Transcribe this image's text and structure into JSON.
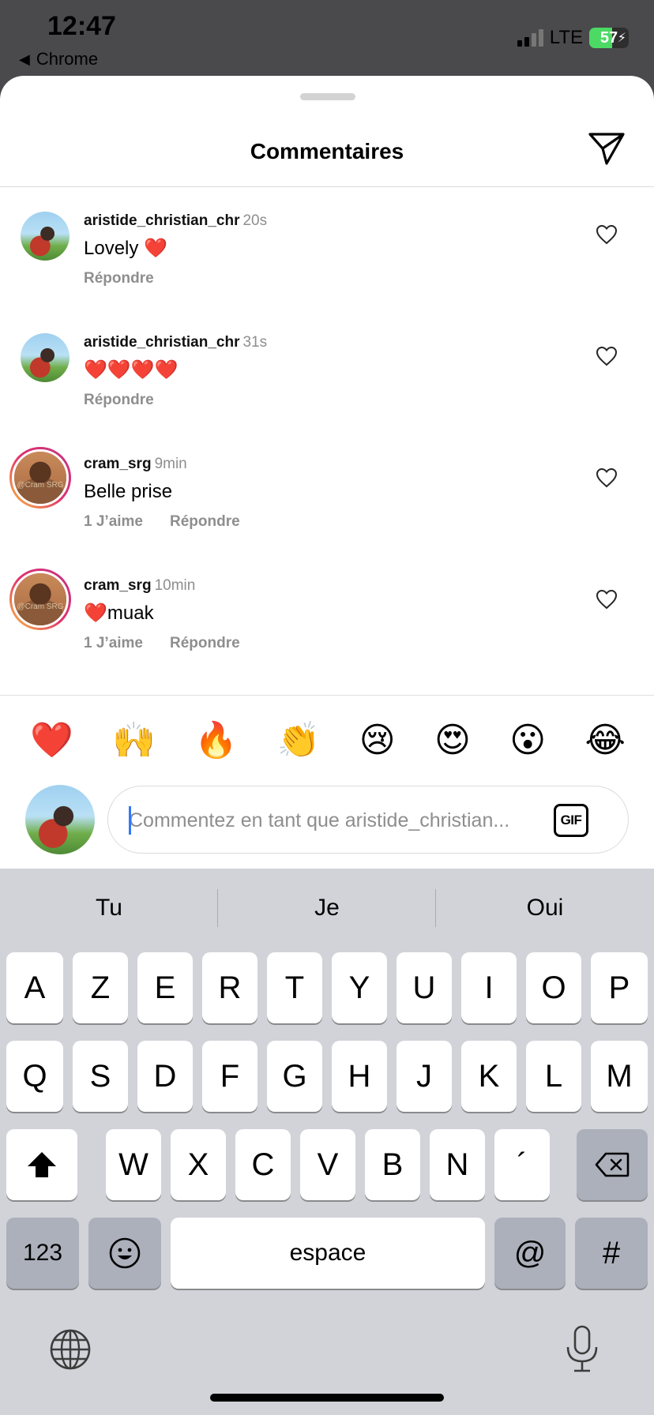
{
  "status_bar": {
    "time": "12:47",
    "back_app": "Chrome",
    "network": "LTE",
    "battery_percent": "57",
    "battery_level": 0.57
  },
  "sheet": {
    "title": "Commentaires",
    "send_icon": "paper-plane-icon"
  },
  "comments": [
    {
      "username": "aristide_christian_chr",
      "time": "20s",
      "text": "Lovely ❤️",
      "likes": "",
      "reply": "Répondre"
    },
    {
      "username": "aristide_christian_chr",
      "time": "31s",
      "text": "❤️❤️❤️❤️",
      "likes": "",
      "reply": "Répondre"
    },
    {
      "username": "cram_srg",
      "time": "9min",
      "text": "Belle prise",
      "likes": "1 J’aime",
      "reply": "Répondre"
    },
    {
      "username": "cram_srg",
      "time": "10min",
      "text": "❤️muak",
      "likes": "1 J’aime",
      "reply": "Répondre"
    }
  ],
  "quick_emojis": [
    "❤️",
    "🙌",
    "🔥",
    "👏",
    "😢",
    "😍",
    "😮",
    "😂"
  ],
  "composer": {
    "placeholder": "Commentez en tant que aristide_christian...",
    "gif_label": "GIF"
  },
  "keyboard": {
    "suggestions": [
      "Tu",
      "Je",
      "Oui"
    ],
    "row1": [
      "A",
      "Z",
      "E",
      "R",
      "T",
      "Y",
      "U",
      "I",
      "O",
      "P"
    ],
    "row2": [
      "Q",
      "S",
      "D",
      "F",
      "G",
      "H",
      "J",
      "K",
      "L",
      "M"
    ],
    "row3": [
      "W",
      "X",
      "C",
      "V",
      "B",
      "N",
      "´"
    ],
    "numbers_label": "123",
    "space_label": "espace",
    "at_label": "@",
    "hash_label": "#"
  },
  "avatar_watermark": "@Cram SRG"
}
